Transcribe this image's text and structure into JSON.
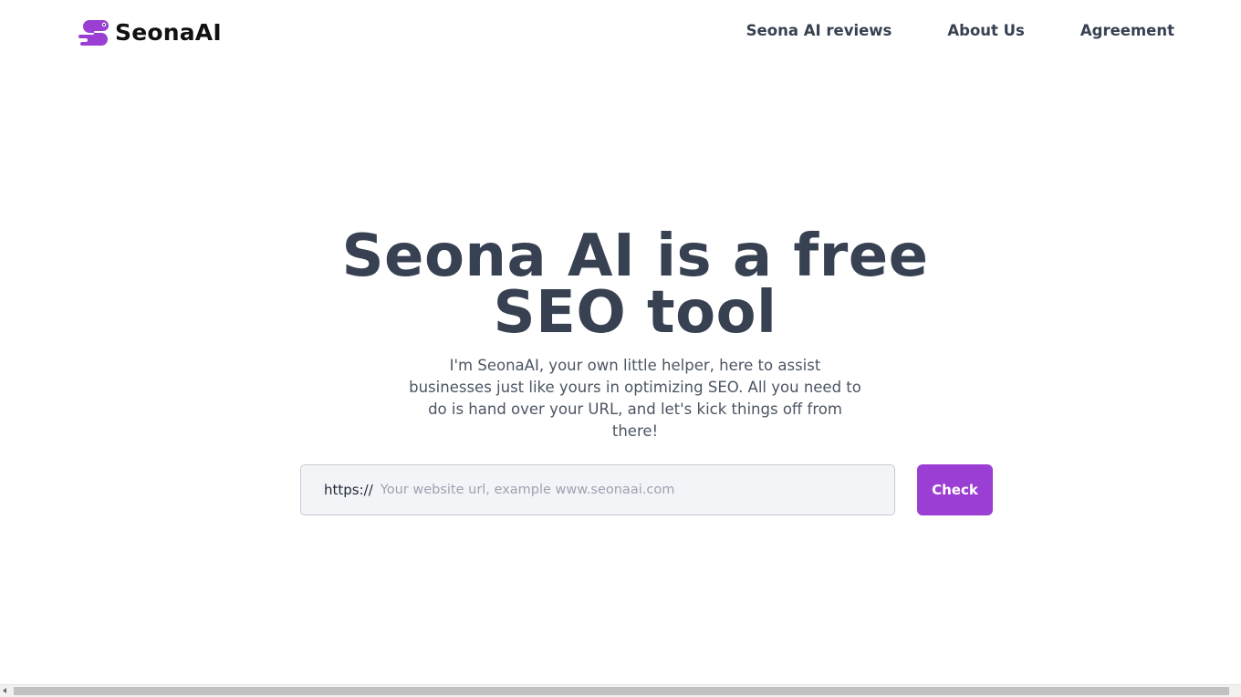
{
  "header": {
    "logo_text": "SeonaAI",
    "logo_icon": "snake-mascot-icon",
    "brand_color": "#9b3fd4",
    "nav": [
      {
        "label": "Seona AI reviews"
      },
      {
        "label": "About Us"
      },
      {
        "label": "Agreement"
      }
    ]
  },
  "hero": {
    "title": "Seona AI is a free SEO tool",
    "subtitle": "I'm SeonaAI, your own little helper, here to assist businesses just like yours in optimizing SEO. All you need to do is hand over your URL, and let's kick things off from there!"
  },
  "search": {
    "prefix": "https://",
    "value": "",
    "placeholder": "Your website url, example www.seonaai.com",
    "button_label": "Check"
  }
}
